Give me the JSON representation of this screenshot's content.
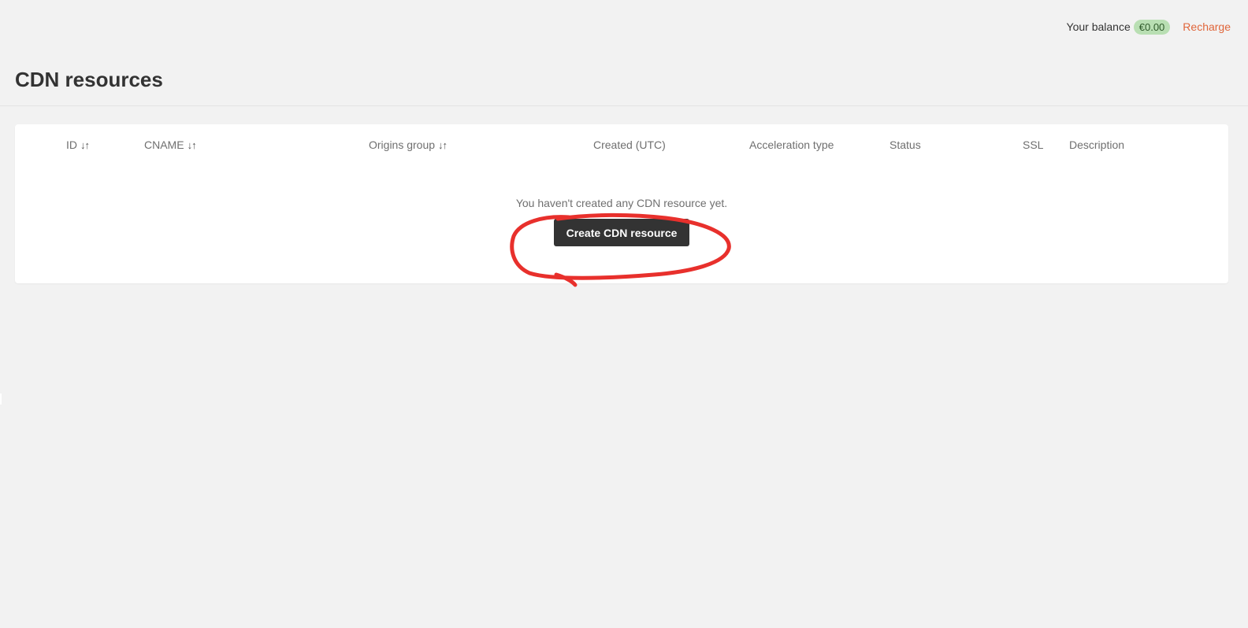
{
  "topbar": {
    "balance_label": "Your balance",
    "balance_value": "€0.00",
    "recharge_label": "Recharge"
  },
  "header": {
    "title": "CDN resources"
  },
  "table": {
    "columns": [
      {
        "label": "ID",
        "sortable": true
      },
      {
        "label": "CNAME",
        "sortable": true
      },
      {
        "label": "Origins group",
        "sortable": true
      },
      {
        "label": "Created (UTC)",
        "sortable": false
      },
      {
        "label": "Acceleration type",
        "sortable": false
      },
      {
        "label": "Status",
        "sortable": false
      },
      {
        "label": "SSL",
        "sortable": false
      },
      {
        "label": "Description",
        "sortable": false
      }
    ],
    "sort_glyph": "↓↑",
    "empty_message": "You haven't created any CDN resource yet.",
    "create_button_label": "Create CDN resource"
  },
  "colors": {
    "accent_link": "#e0663b",
    "balance_badge": "#b9dfb3",
    "primary_button": "#333333",
    "annotation": "#e8302c"
  },
  "icons": {
    "sort": "sort-arrows-icon"
  }
}
